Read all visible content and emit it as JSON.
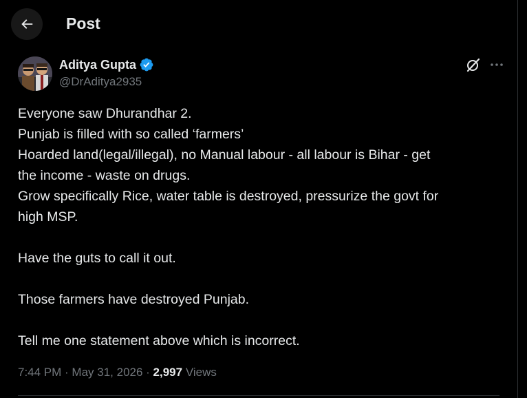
{
  "header": {
    "title": "Post"
  },
  "author": {
    "name": "Aditya Gupta",
    "handle": "@DrAditya2935",
    "verified": true
  },
  "tweet": {
    "lines": [
      "Everyone saw Dhurandhar 2.",
      "Punjab is filled with so called ‘farmers’",
      "Hoarded land(legal/illegal), no Manual labour - all labour is Bihar - get",
      "the income - waste on drugs.",
      "Grow specifically Rice, water table is destroyed, pressurize the govt for",
      "high MSP.",
      "",
      "Have the guts to call it out.",
      "",
      "Those farmers have destroyed Punjab.",
      "",
      "Tell me one statement above which is incorrect."
    ]
  },
  "meta": {
    "time": "7:44 PM",
    "separator1": " · ",
    "date": "May 31, 2026",
    "separator2": " · ",
    "views_count": "2,997",
    "views_label": "Views"
  },
  "icons": {
    "back": "arrow-left-icon",
    "verified": "verified-badge-icon",
    "grok": "grok-icon",
    "more": "more-dots-icon"
  },
  "colors": {
    "background": "#000000",
    "text_primary": "#e7e9ea",
    "text_secondary": "#71767b",
    "verified": "#1d9bf0",
    "divider": "#2f3336"
  }
}
